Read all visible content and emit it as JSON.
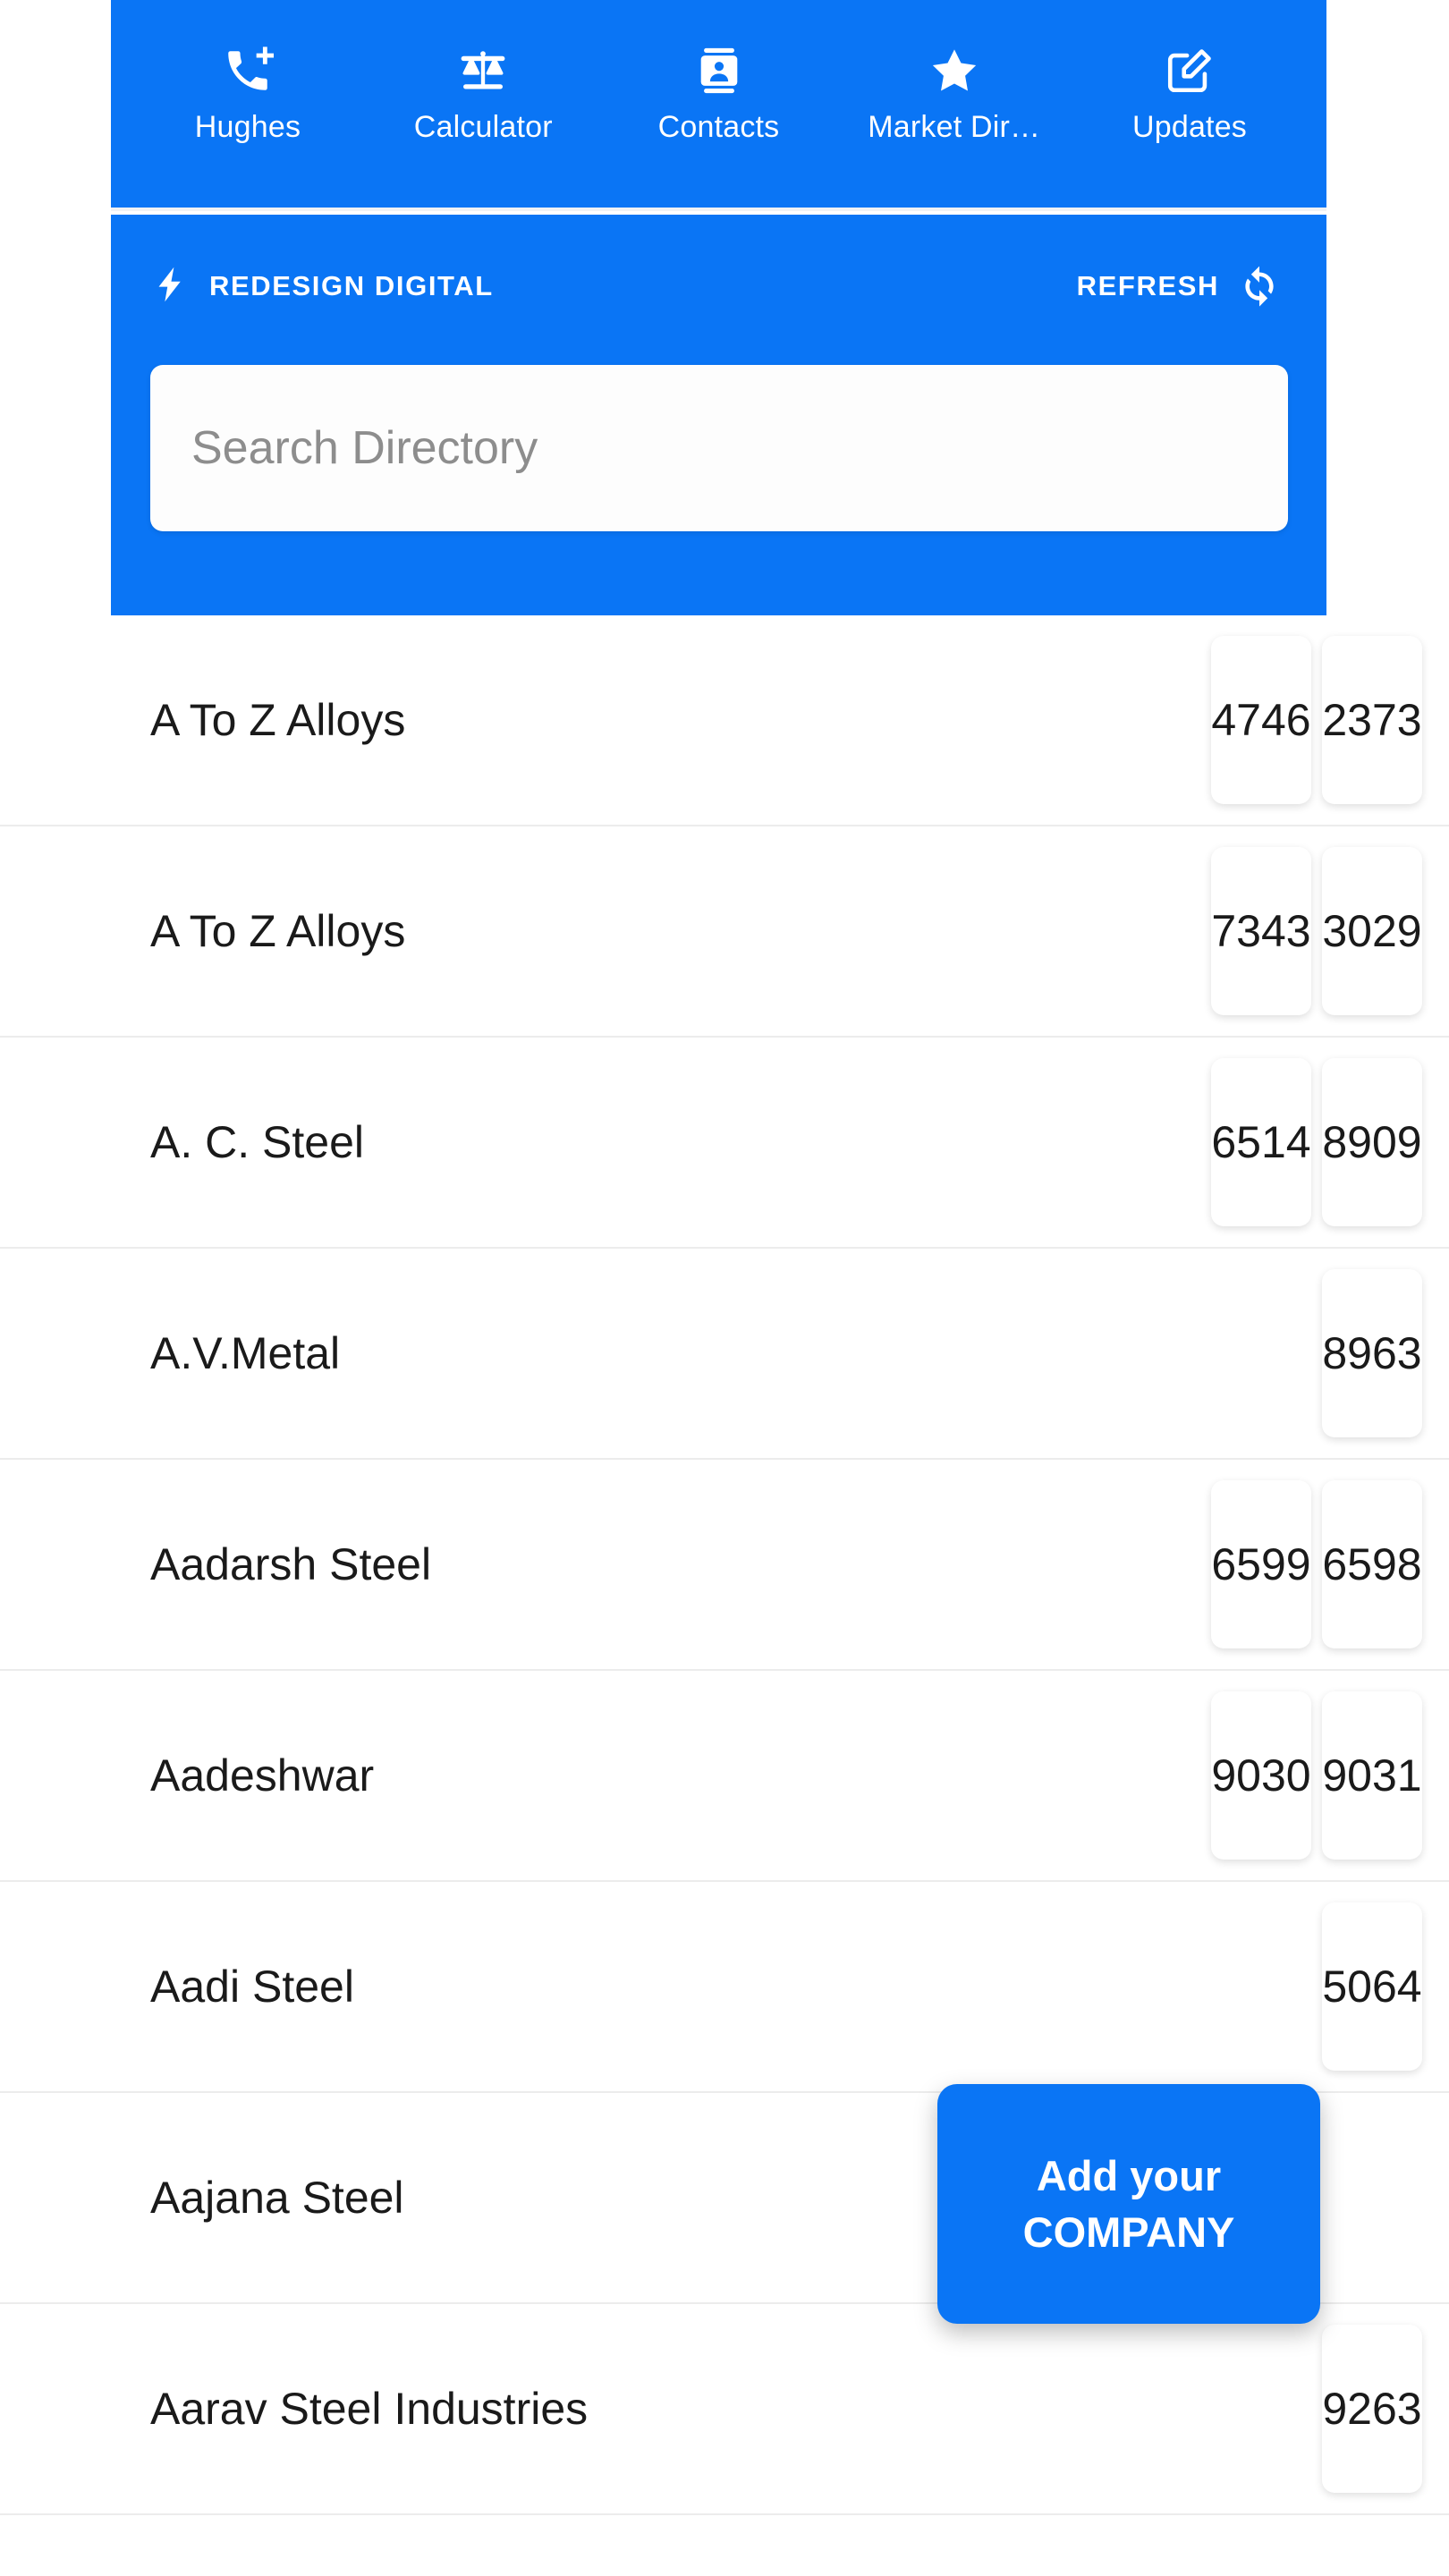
{
  "colors": {
    "brand_blue": "#0a75f5",
    "row_divider": "#ececec",
    "text_dark": "#1a1a1a",
    "placeholder_gray": "#8d8d8d",
    "white": "#ffffff"
  },
  "topnav": {
    "items": [
      {
        "label": "Hughes",
        "icon": "phone-add-icon"
      },
      {
        "label": "Calculator",
        "icon": "scales-balance-icon"
      },
      {
        "label": "Contacts",
        "icon": "contact-card-icon"
      },
      {
        "label": "Market Dir…",
        "icon": "star-icon"
      },
      {
        "label": "Updates",
        "icon": "edit-square-icon"
      }
    ]
  },
  "header": {
    "brand_name": "REDESIGN DIGITAL",
    "brand_icon": "lightning-bolt-icon",
    "refresh_label": "REFRESH",
    "refresh_icon": "sync-refresh-icon"
  },
  "search": {
    "value": "",
    "placeholder": "Search Directory"
  },
  "directory": {
    "rows": [
      {
        "name": "A To Z Alloys",
        "chips": [
          "4746",
          "2373"
        ]
      },
      {
        "name": "A To Z Alloys",
        "chips": [
          "7343",
          "3029"
        ]
      },
      {
        "name": "A. C. Steel",
        "chips": [
          "6514",
          "8909"
        ]
      },
      {
        "name": "A.V.Metal",
        "chips": [
          "8963"
        ]
      },
      {
        "name": "Aadarsh Steel",
        "chips": [
          "6599",
          "6598"
        ]
      },
      {
        "name": "Aadeshwar",
        "chips": [
          "9030",
          "9031"
        ]
      },
      {
        "name": "Aadi Steel",
        "chips": [
          "5064"
        ]
      },
      {
        "name": "Aajana Steel",
        "chips": []
      },
      {
        "name": "Aarav Steel Industries",
        "chips": [
          "9263"
        ]
      }
    ]
  },
  "add_company_button": {
    "line1": "Add your",
    "line2": "COMPANY"
  }
}
